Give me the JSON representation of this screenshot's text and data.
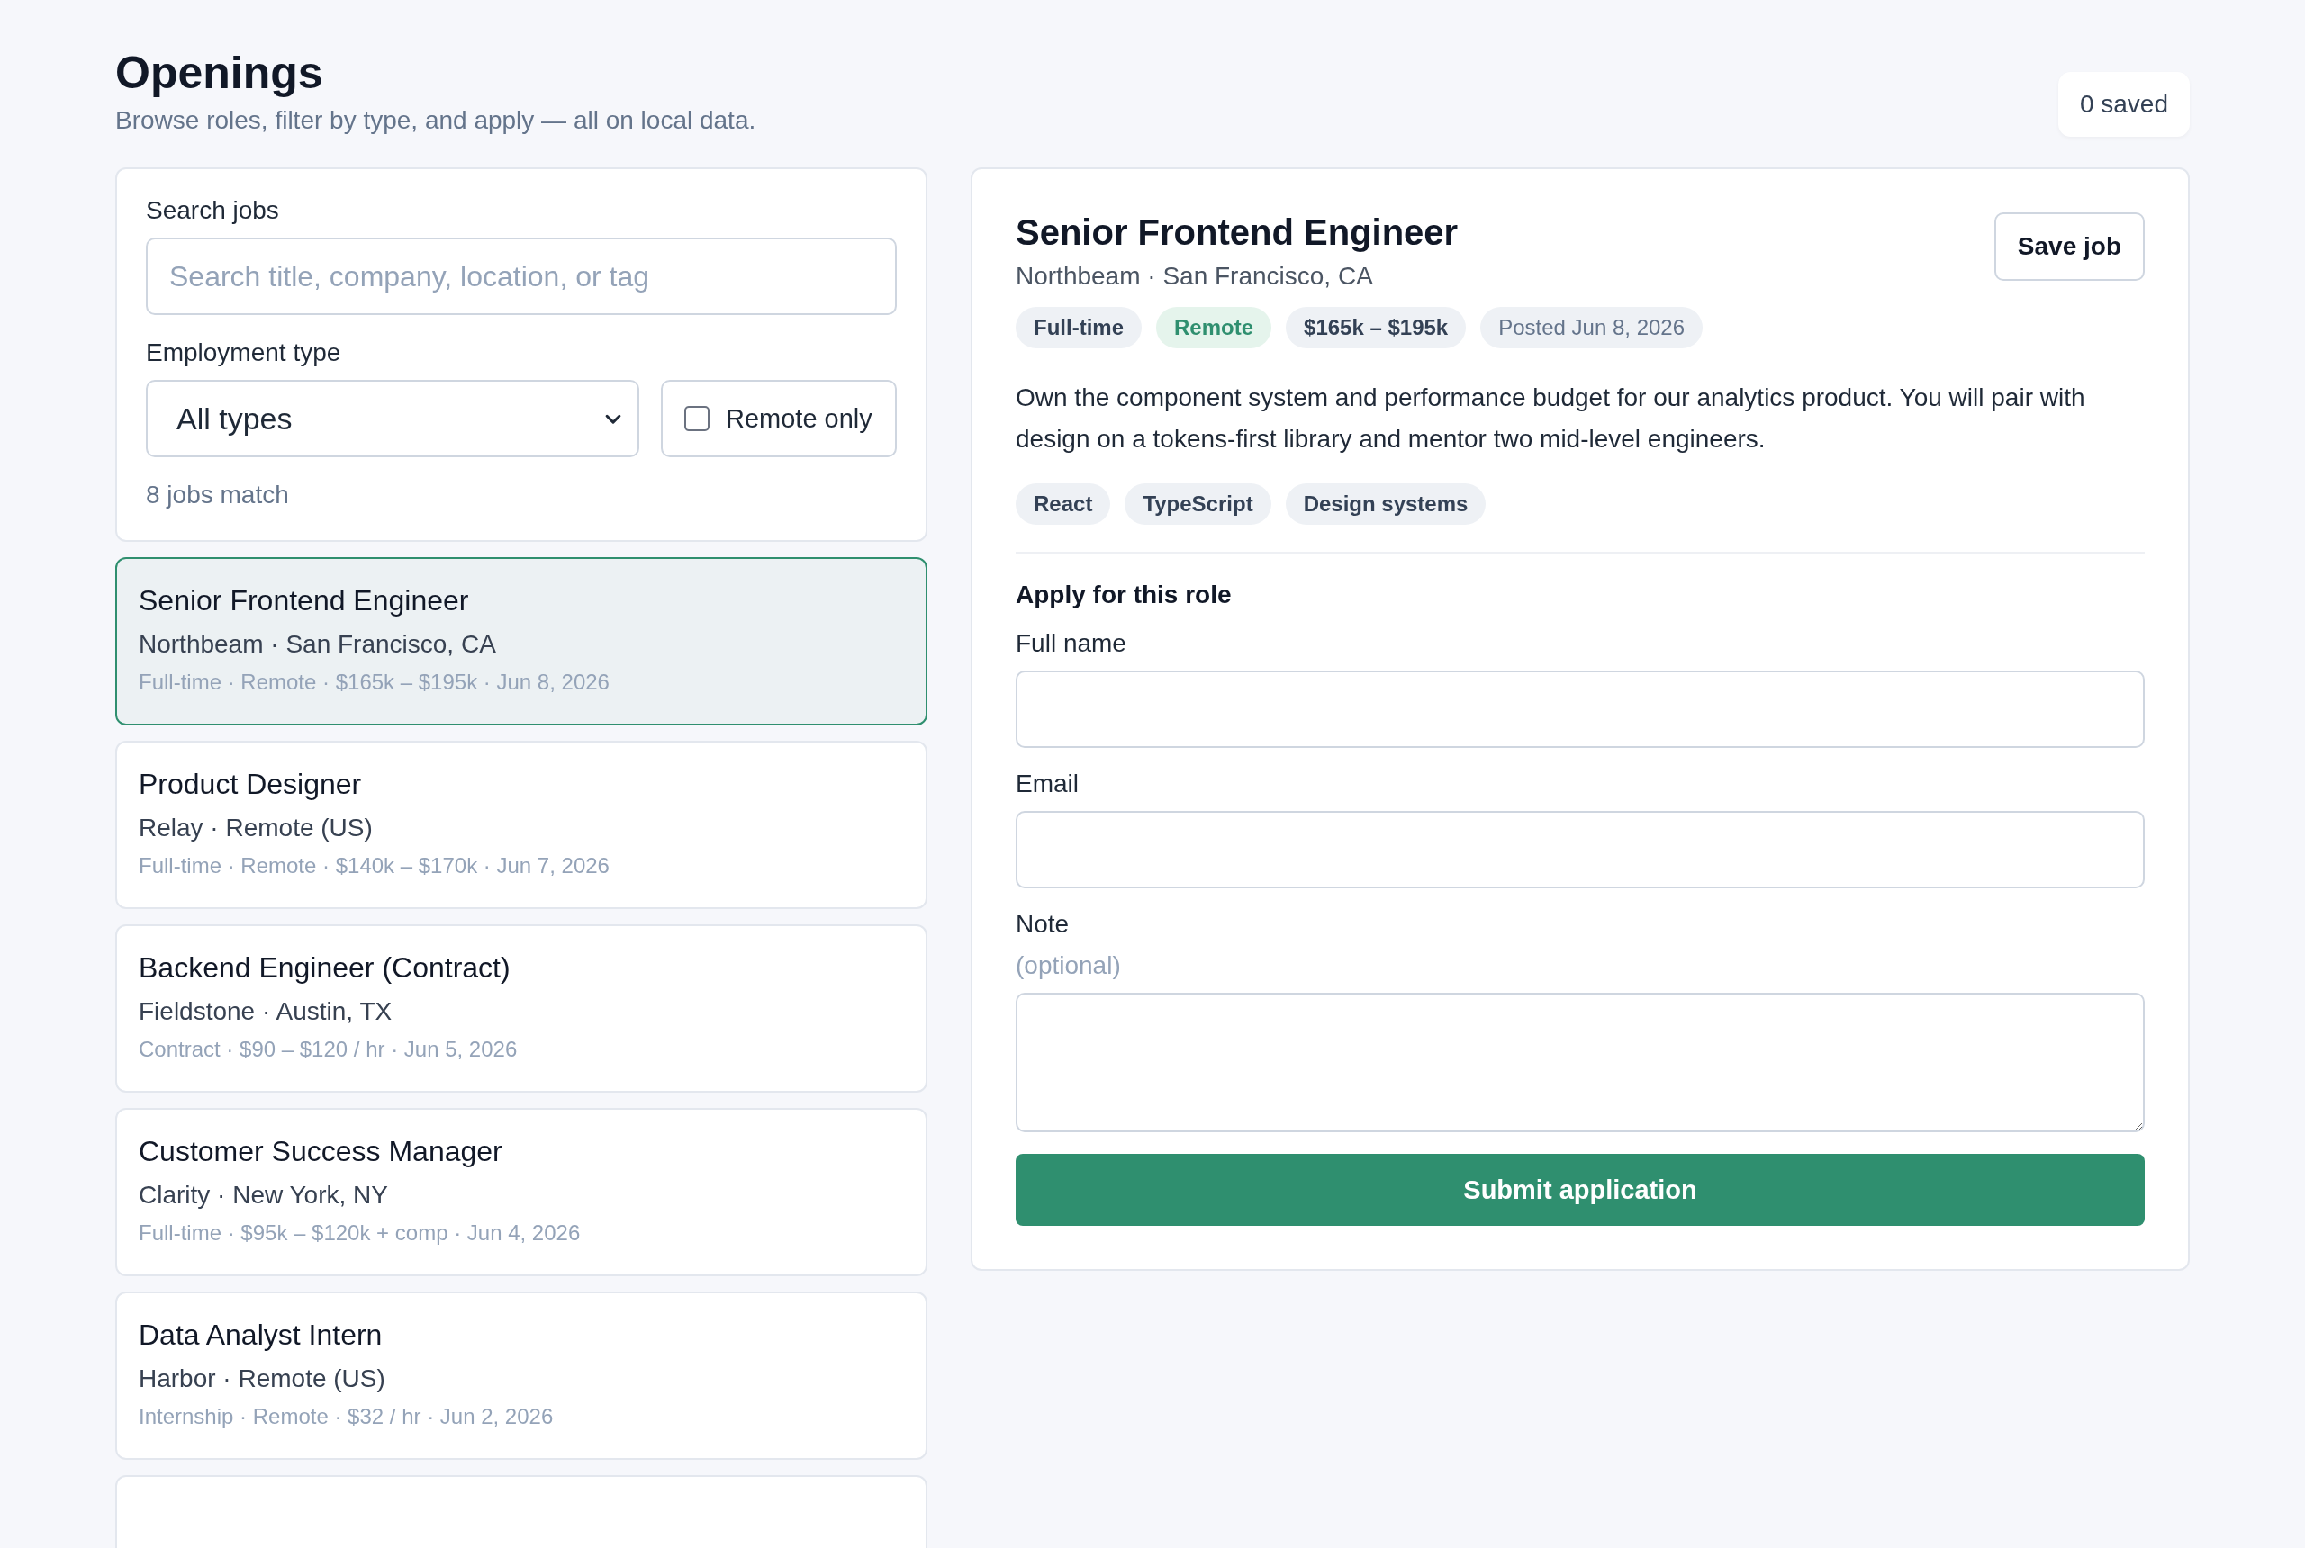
{
  "header": {
    "title": "Openings",
    "subtitle": "Browse roles, filter by type, and apply — all on local data.",
    "saved_count": "0 saved"
  },
  "filters": {
    "search_label": "Search jobs",
    "search_placeholder": "Search title, company, location, or tag",
    "type_label": "Employment type",
    "type_value": "All types",
    "remote": {
      "label": "Remote only",
      "checked": false
    },
    "match_count": "8 jobs match"
  },
  "jobs": [
    {
      "kind": "card",
      "title": "Senior Frontend Engineer",
      "company_location": "Northbeam · San Francisco, CA",
      "meta": "Full-time · Remote · $165k – $195k · Jun 8, 2026",
      "selected": true
    },
    {
      "kind": "card",
      "title": "Product Designer",
      "company_location": "Relay · Remote (US)",
      "meta": "Full-time · Remote · $140k – $170k · Jun 7, 2026",
      "selected": false
    },
    {
      "kind": "card",
      "title": "Backend Engineer (Contract)",
      "company_location": "Fieldstone · Austin, TX",
      "meta": "Contract · $90 – $120 / hr · Jun 5, 2026",
      "selected": false
    },
    {
      "kind": "card",
      "title": "Customer Success Manager",
      "company_location": "Clarity · New York, NY",
      "meta": "Full-time · $95k – $120k + comp · Jun 4, 2026",
      "selected": false
    },
    {
      "kind": "card",
      "title": "Data Analyst Intern",
      "company_location": "Harbor · Remote (US)",
      "meta": "Internship · Remote · $32 / hr · Jun 2, 2026",
      "selected": false
    },
    {
      "kind": "cut"
    }
  ],
  "detail": {
    "title": "Senior Frontend Engineer",
    "company_location": "Northbeam · San Francisco, CA",
    "save_button": "Save job",
    "chips": [
      {
        "text": "Full-time",
        "kind": "type"
      },
      {
        "text": "Remote",
        "kind": "remote"
      },
      {
        "text": "$165k – $195k",
        "kind": "salary"
      },
      {
        "text": "Posted Jun 8, 2026",
        "kind": "posted"
      }
    ],
    "description": "Own the component system and performance budget for our analytics product. You will pair with design on a tokens-first library and mentor two mid-level engineers.",
    "tags": [
      "React",
      "TypeScript",
      "Design systems"
    ],
    "apply": {
      "heading": "Apply for this role",
      "fields": [
        {
          "label": "Full name",
          "kind": "input"
        },
        {
          "label": "Email",
          "kind": "input"
        },
        {
          "label": "Note",
          "hint": "(optional)",
          "kind": "textarea"
        }
      ],
      "submit": "Submit application"
    }
  }
}
